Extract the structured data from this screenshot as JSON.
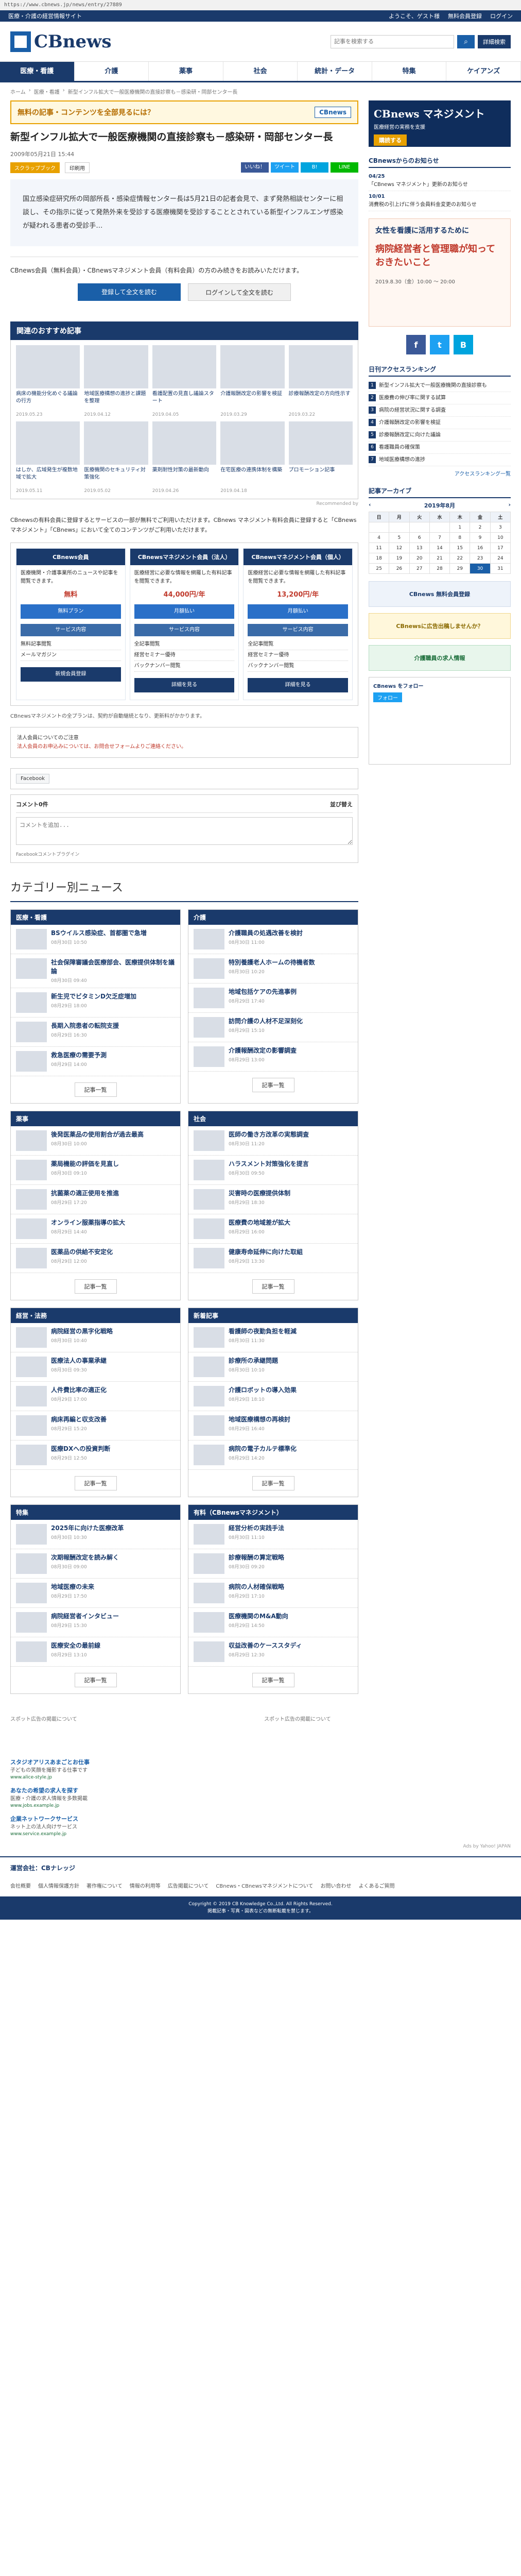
{
  "browser": {
    "url": "https://www.cbnews.jp/news/entry/27889"
  },
  "topbar": {
    "left": [
      "医療・介護の経営情報サイト"
    ],
    "right": [
      "ようこそ、ゲスト様",
      "無料会員登録",
      "ログイン"
    ]
  },
  "header": {
    "logo": "CBnews",
    "search_placeholder": "記事を検索する",
    "detail_search": "詳細検索"
  },
  "nav": [
    "医療・看護",
    "介護",
    "薬事",
    "社会",
    "統計・データ",
    "特集",
    "ケイアンズ"
  ],
  "breadcrumb": [
    "ホーム",
    "医療・看護",
    "新型インフル拡大で一般医療機関の直接診察も－感染研・岡部センター長"
  ],
  "promo": {
    "text": "無料の記事・コンテンツを全部見るには？",
    "logo": "CBnews"
  },
  "article": {
    "title": "新型インフル拡大で一般医療機関の直接診察も－感染研・岡部センター長",
    "date": "2009年05月21日 15:44",
    "tag": "スクラップブック",
    "tag2": "印刷用",
    "share": [
      "いいね！",
      "ツイート",
      "B!",
      "LINE"
    ],
    "lead": "国立感染症研究所の岡部所長・感染症情報センター長は5月21日の記者会見で、まず発熱相談センターに相談し、その指示に従って発熱外来を受診する医療機関を受診することとされている新型インフルエンザ感染が疑われる患者の受診手…"
  },
  "paywall": {
    "text": "CBnews会員（無料会員）・CBnewsマネジメント会員（有料会員）の方のみ続きをお読みいただけます。",
    "btn_register": "登録して全文を読む",
    "btn_login": "ログインして全文を読む"
  },
  "recommend": {
    "title": "関連のおすすめ記事",
    "items": [
      {
        "title": "病床の機能分化めぐる議論の行方",
        "date": "2019.05.23"
      },
      {
        "title": "地域医療構想の進捗と課題を整理",
        "date": "2019.04.12"
      },
      {
        "title": "看護配置の見直し議論スタート",
        "date": "2019.04.05"
      },
      {
        "title": "介護報酬改定の影響を検証",
        "date": "2019.03.29"
      },
      {
        "title": "診療報酬改定の方向性示す",
        "date": "2019.03.22"
      },
      {
        "title": "はしか、広域発生が複数地域で拡大",
        "date": "2019.05.11"
      },
      {
        "title": "医療機関のセキュリティ対策強化",
        "date": "2019.05.02"
      },
      {
        "title": "薬剤耐性対策の最新動向",
        "date": "2019.04.26"
      },
      {
        "title": "在宅医療の連携体制を構築",
        "date": "2019.04.18"
      },
      {
        "title": "プロモーション記事",
        "date": ""
      }
    ],
    "note": "Recommended by"
  },
  "plans": {
    "intro": "CBnewsの有料会員に登録するとサービスの一部が無料でご利用いただけます。CBnews マネジメント有料会員に登録すると「CBnews マネジメント」「CBnews」において全てのコンテンツがご利用いただけます。",
    "cols": [
      {
        "head": "CBnews会員",
        "desc": "医療機関・介護事業所のニュースや記事を閲覧できます。",
        "price": "無料",
        "btn": "無料プラン",
        "services": [
          "サービス内容",
          "無料記事閲覧",
          "メールマガジン"
        ],
        "cta": "新規会員登録"
      },
      {
        "head": "CBnewsマネジメント会員（法人）",
        "desc": "医療経営に必要な情報を網羅した有料記事を閲覧できます。",
        "price": "44,000円/年",
        "btn": "月額払い",
        "services": [
          "サービス内容",
          "全記事閲覧",
          "経営セミナー優待",
          "バックナンバー閲覧"
        ],
        "cta": "詳細を見る"
      },
      {
        "head": "CBnewsマネジメント会員（個人）",
        "desc": "医療経営に必要な情報を網羅した有料記事を閲覧できます。",
        "price": "13,200円/年",
        "btn": "月額払い",
        "services": [
          "サービス内容",
          "全記事閲覧",
          "経営セミナー優待",
          "バックナンバー閲覧"
        ],
        "cta": "詳細を見る"
      }
    ],
    "note": "CBnewsマネジメントの全プランは、契約が自動継続となり、更新料がかかります。",
    "contact": "法人会員についてのご注意",
    "contact_red": "法人会員のお申込みについては、お問合せフォームよりご連絡ください。"
  },
  "facebook": {
    "btn": "Facebook"
  },
  "comments": {
    "count": "コメント0件",
    "sort": "並び替え",
    "placeholder": "コメントを追加...",
    "plugin": "Facebookコメントプラグイン"
  },
  "categories": {
    "title": "カテゴリー別ニュース",
    "boxes": [
      {
        "head": "医療・看護",
        "items": [
          {
            "t": "BSウイルス感染症、首都圏で急増",
            "d": "08月30日 10:50"
          },
          {
            "t": "社会保障審議会医療部会、医療提供体制を議論",
            "d": "08月30日 09:40"
          },
          {
            "t": "新生児でビタミンD欠乏症増加",
            "d": "08月29日 18:00"
          },
          {
            "t": "長期入院患者の転院支援",
            "d": "08月29日 16:30"
          },
          {
            "t": "救急医療の需要予測",
            "d": "08月29日 14:00"
          }
        ],
        "more": "記事一覧"
      },
      {
        "head": "介護",
        "items": [
          {
            "t": "介護職員の処遇改善を検討",
            "d": "08月30日 11:00"
          },
          {
            "t": "特別養護老人ホームの待機者数",
            "d": "08月30日 10:20"
          },
          {
            "t": "地域包括ケアの先進事例",
            "d": "08月29日 17:40"
          },
          {
            "t": "訪問介護の人材不足深刻化",
            "d": "08月29日 15:10"
          },
          {
            "t": "介護報酬改定の影響調査",
            "d": "08月29日 13:00"
          }
        ],
        "more": "記事一覧"
      },
      {
        "head": "薬事",
        "items": [
          {
            "t": "後発医薬品の使用割合が過去最高",
            "d": "08月30日 10:00"
          },
          {
            "t": "薬局機能の評価を見直し",
            "d": "08月30日 09:10"
          },
          {
            "t": "抗菌薬の適正使用を推進",
            "d": "08月29日 17:20"
          },
          {
            "t": "オンライン服薬指導の拡大",
            "d": "08月29日 14:40"
          },
          {
            "t": "医薬品の供給不安定化",
            "d": "08月29日 12:00"
          }
        ],
        "more": "記事一覧"
      },
      {
        "head": "社会",
        "items": [
          {
            "t": "医師の働き方改革の実態調査",
            "d": "08月30日 11:20"
          },
          {
            "t": "ハラスメント対策強化を提言",
            "d": "08月30日 09:50"
          },
          {
            "t": "災害時の医療提供体制",
            "d": "08月29日 18:30"
          },
          {
            "t": "医療費の地域差が拡大",
            "d": "08月29日 16:00"
          },
          {
            "t": "健康寿命延伸に向けた取組",
            "d": "08月29日 13:30"
          }
        ],
        "more": "記事一覧"
      },
      {
        "head": "経営・法務",
        "items": [
          {
            "t": "病院経営の黒字化戦略",
            "d": "08月30日 10:40"
          },
          {
            "t": "医療法人の事業承継",
            "d": "08月30日 09:30"
          },
          {
            "t": "人件費比率の適正化",
            "d": "08月29日 17:00"
          },
          {
            "t": "病床再編と収支改善",
            "d": "08月29日 15:20"
          },
          {
            "t": "医療DXへの投資判断",
            "d": "08月29日 12:50"
          }
        ],
        "more": "記事一覧"
      },
      {
        "head": "新着記事",
        "items": [
          {
            "t": "看護師の夜勤負担を軽減",
            "d": "08月30日 11:30"
          },
          {
            "t": "診療所の承継問題",
            "d": "08月30日 10:10"
          },
          {
            "t": "介護ロボットの導入効果",
            "d": "08月29日 18:10"
          },
          {
            "t": "地域医療構想の再検討",
            "d": "08月29日 16:40"
          },
          {
            "t": "病院の電子カルテ標準化",
            "d": "08月29日 14:20"
          }
        ],
        "more": "記事一覧"
      },
      {
        "head": "特集",
        "items": [
          {
            "t": "2025年に向けた医療改革",
            "d": "08月30日 10:30"
          },
          {
            "t": "次期報酬改定を読み解く",
            "d": "08月30日 09:00"
          },
          {
            "t": "地域医療の未来",
            "d": "08月29日 17:50"
          },
          {
            "t": "病院経営者インタビュー",
            "d": "08月29日 15:30"
          },
          {
            "t": "医療安全の最前線",
            "d": "08月29日 13:10"
          }
        ],
        "more": "記事一覧"
      },
      {
        "head": "有料（CBnewsマネジメント）",
        "items": [
          {
            "t": "経営分析の実践手法",
            "d": "08月30日 11:10"
          },
          {
            "t": "診療報酬の算定戦略",
            "d": "08月30日 09:20"
          },
          {
            "t": "病院の人材確保戦略",
            "d": "08月29日 17:10"
          },
          {
            "t": "医療機関のM&A動向",
            "d": "08月29日 14:50"
          },
          {
            "t": "収益改善のケーススタディ",
            "d": "08月29日 12:30"
          }
        ],
        "more": "記事一覧"
      }
    ]
  },
  "sidebar": {
    "banner": {
      "t1": "CBnews マネジメント",
      "t2": "医療経営の実務を支援",
      "btn": "購読する"
    },
    "notice_title": "CBnewsからのお知らせ",
    "notices": [
      {
        "date": "04/25",
        "text": "「CBnews マネジメント」更新のお知らせ"
      },
      {
        "date": "10/01",
        "text": "消費税の引上げに伴う会員料金変更のお知らせ"
      }
    ],
    "ad_tall": {
      "t1": "女性を看護に活用するために",
      "t2": "病院経営者と管理職が知っておきたいこと",
      "t3": "2019.8.30（金）10:00 〜 20:00"
    },
    "sns": [
      "f",
      "t",
      "B"
    ],
    "ranking_title": "日刊アクセスランキング",
    "ranking": [
      "新型インフル拡大で一般医療機関の直接診察も",
      "医療費の伸び率に関する試算",
      "病院の経営状況に関する調査",
      "介護報酬改定の影響を検証",
      "診療報酬改定に向けた議論",
      "看護職員の確保策",
      "地域医療構想の進捗"
    ],
    "ranking_more": "アクセスランキング一覧",
    "archive_title": "記事アーカイブ",
    "archive_month": "2019年8月",
    "weekdays": [
      "日",
      "月",
      "火",
      "水",
      "木",
      "金",
      "土"
    ],
    "calendar": [
      [
        "",
        "",
        "",
        "",
        "1",
        "2",
        "3"
      ],
      [
        "4",
        "5",
        "6",
        "7",
        "8",
        "9",
        "10"
      ],
      [
        "11",
        "12",
        "13",
        "14",
        "15",
        "16",
        "17"
      ],
      [
        "18",
        "19",
        "20",
        "21",
        "22",
        "23",
        "24"
      ],
      [
        "25",
        "26",
        "27",
        "28",
        "29",
        "30",
        "31"
      ]
    ],
    "ad1": "CBnews 無料会員登録",
    "ad2": "CBnewsに広告出稿しませんか？",
    "ad3": "介護職員の求人情報",
    "twitter_head": "CBnews をフォロー",
    "twitter_follow": "フォロー"
  },
  "bottom_ads": [
    "スポット広告の掲載について",
    "スポット広告の掲載について"
  ],
  "jobs": {
    "items": [
      {
        "t": "スタジオアリスあまごとお仕事",
        "d": "子どもの笑顔を撮影する仕事です",
        "u": "www.alice-style.jp"
      },
      {
        "t": "あなたの希望の求人を探す",
        "d": "医療・介護の求人情報を多数掲載",
        "u": "www.jobs.example.jp"
      },
      {
        "t": "企業ネットワークサービス",
        "d": "ネット上の法人向けサービス",
        "u": "www.service.example.jp"
      }
    ],
    "adsby": "Ads by Yahoo! JAPAN"
  },
  "footer": {
    "company": "運営会社：CBナレッジ",
    "links": [
      "会社概要",
      "個人情報保護方針",
      "著作権について",
      "情報の利用等",
      "広告掲載について",
      "CBnews・CBnewsマネジメントについて",
      "お問い合わせ",
      "よくあるご質問"
    ],
    "copyright": "Copyright © 2019 CB Knowledge Co.,Ltd. All Rights Reserved.",
    "sub": "掲載記事・写真・図表などの無断転載を禁じます。"
  }
}
